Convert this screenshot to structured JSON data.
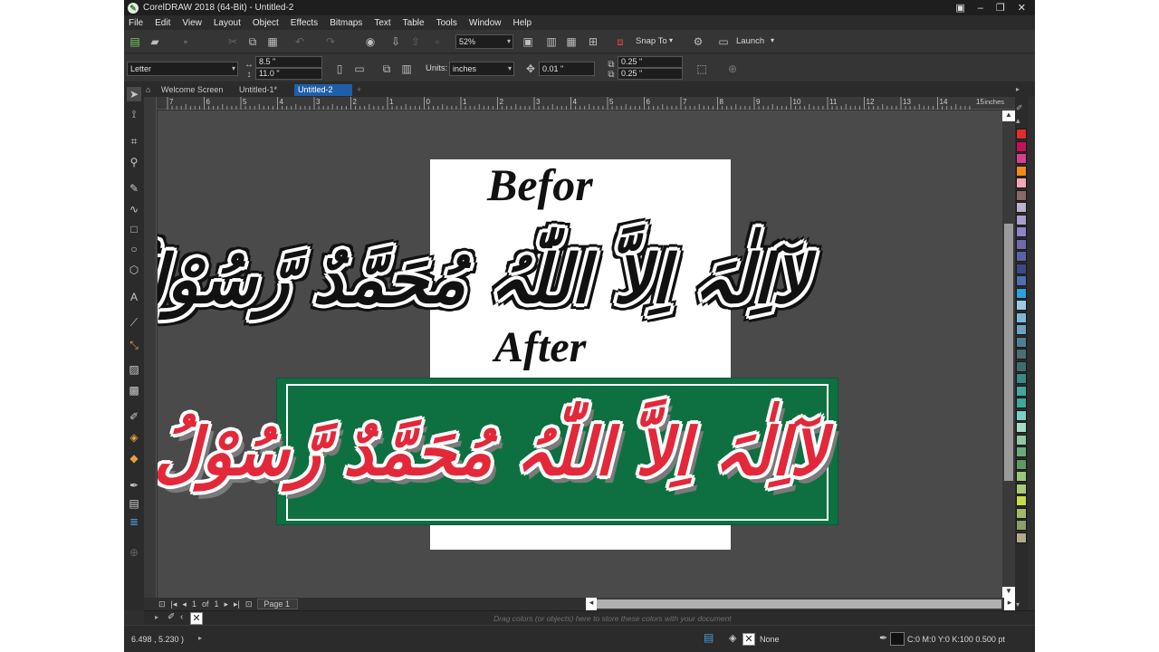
{
  "window": {
    "title": "CorelDRAW 2018 (64-Bit) - Untitled-2"
  },
  "menu": [
    "File",
    "Edit",
    "View",
    "Layout",
    "Object",
    "Effects",
    "Bitmaps",
    "Text",
    "Table",
    "Tools",
    "Window",
    "Help"
  ],
  "toolbar": {
    "zoom": "52%",
    "snap_to": "Snap To",
    "launch": "Launch"
  },
  "property_bar": {
    "page_size": "Letter",
    "width": "8.5 \"",
    "height": "11.0 \"",
    "units_label": "Units:",
    "units_value": "inches",
    "nudge": "0.01 \"",
    "dup_x": "0.25 \"",
    "dup_y": "0.25 \""
  },
  "tabs": [
    "Welcome Screen",
    "Untitled-1*",
    "Untitled-2"
  ],
  "ruler": {
    "top_ticks": [
      "7",
      "6",
      "5",
      "4",
      "3",
      "2",
      "1",
      "0",
      "1",
      "2",
      "3",
      "4",
      "5",
      "6",
      "7",
      "8",
      "9",
      "10",
      "11",
      "12",
      "13",
      "14",
      "15"
    ],
    "unit": "inches"
  },
  "canvas": {
    "label_before": "Befor",
    "label_after": "After",
    "calligraphy_before": "لآاِلٰہَ اِلاَّ اللّٰہُ مُحَمَّدٌ رَّسُوْلُ اللّٰہ",
    "calligraphy_after": "لآاِلٰہَ اِلاَّ اللّٰہُ مُحَمَّدٌ رَّسُوْلُ اللّٰہ",
    "banner_color": "#0e7040",
    "text_color_after": "#e3283a"
  },
  "page_nav": {
    "current": "1",
    "of_label": "of",
    "total": "1",
    "page_tab": "Page 1"
  },
  "document_palette_hint": "Drag colors (or objects) here to store these colors with your document",
  "status": {
    "coords": "6.498 , 5.230 )",
    "fill": "None",
    "outline": "C:0 M:0 Y:0 K:100  0.500 pt"
  },
  "palette_colors": [
    "#e52b2b",
    "#c8105a",
    "#d64090",
    "#f08a1e",
    "#f4a7b0",
    "#8a6a64",
    "#bcb2cc",
    "#a89fcf",
    "#8d83c6",
    "#6f6aae",
    "#5b62a6",
    "#3d4a88",
    "#4d6fb5",
    "#2aa3d8",
    "#9ec9e6",
    "#7db7d8",
    "#6fa2c2",
    "#4f7f94",
    "#4e6d72",
    "#3f6e6a",
    "#3a8a84",
    "#45a89a",
    "#3aa9a0",
    "#7ccfc4",
    "#a9d9c7",
    "#8fc8a3",
    "#6aab7c",
    "#5c9a64",
    "#9bc77a",
    "#a8c97a",
    "#c4db4a",
    "#a3b86a",
    "#8c9e6a",
    "#b0a98a"
  ]
}
